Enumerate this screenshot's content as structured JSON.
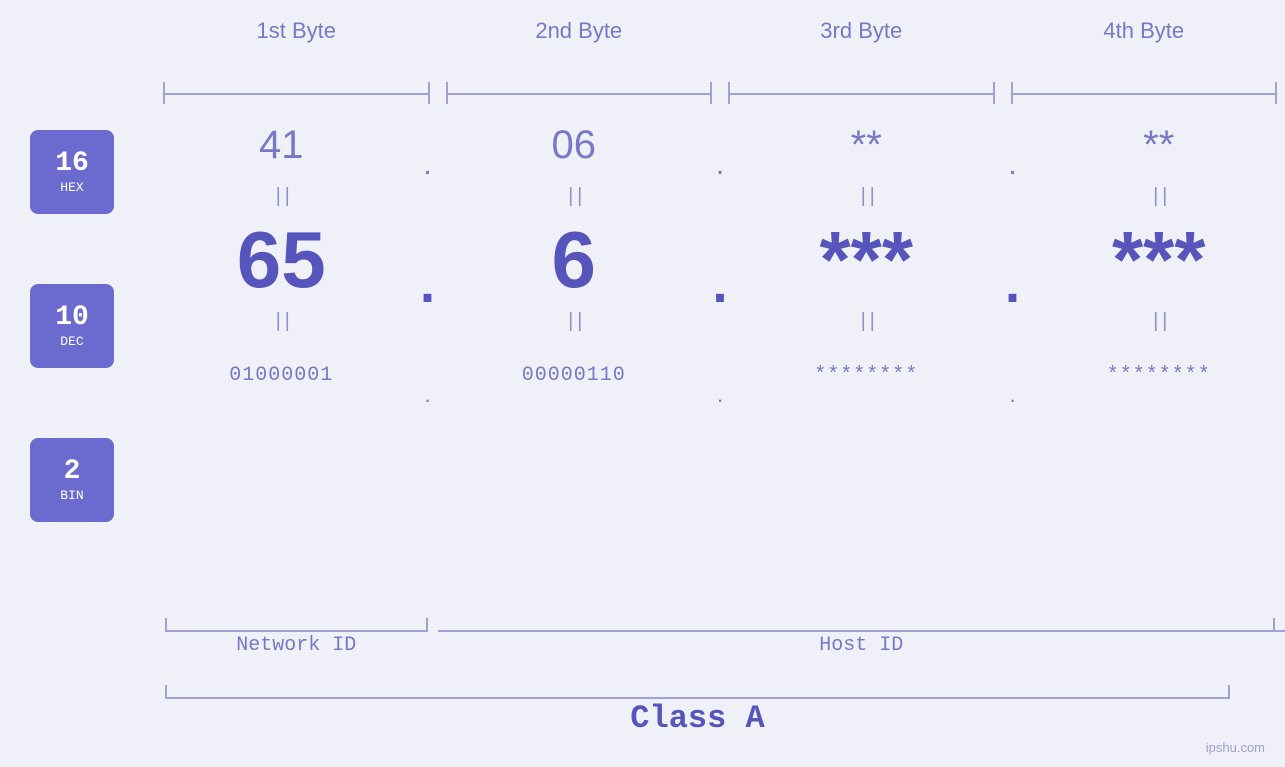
{
  "header": {
    "byte1_label": "1st Byte",
    "byte2_label": "2nd Byte",
    "byte3_label": "3rd Byte",
    "byte4_label": "4th Byte"
  },
  "badges": {
    "hex": {
      "number": "16",
      "label": "HEX"
    },
    "dec": {
      "number": "10",
      "label": "DEC"
    },
    "bin": {
      "number": "2",
      "label": "BIN"
    }
  },
  "bytes": [
    {
      "hex": "41",
      "dec": "65",
      "bin": "01000001"
    },
    {
      "hex": "06",
      "dec": "6",
      "bin": "00000110"
    },
    {
      "hex": "**",
      "dec": "***",
      "bin": "********"
    },
    {
      "hex": "**",
      "dec": "***",
      "bin": "********"
    }
  ],
  "labels": {
    "network_id": "Network ID",
    "host_id": "Host ID",
    "class": "Class A"
  },
  "watermark": "ipshu.com"
}
